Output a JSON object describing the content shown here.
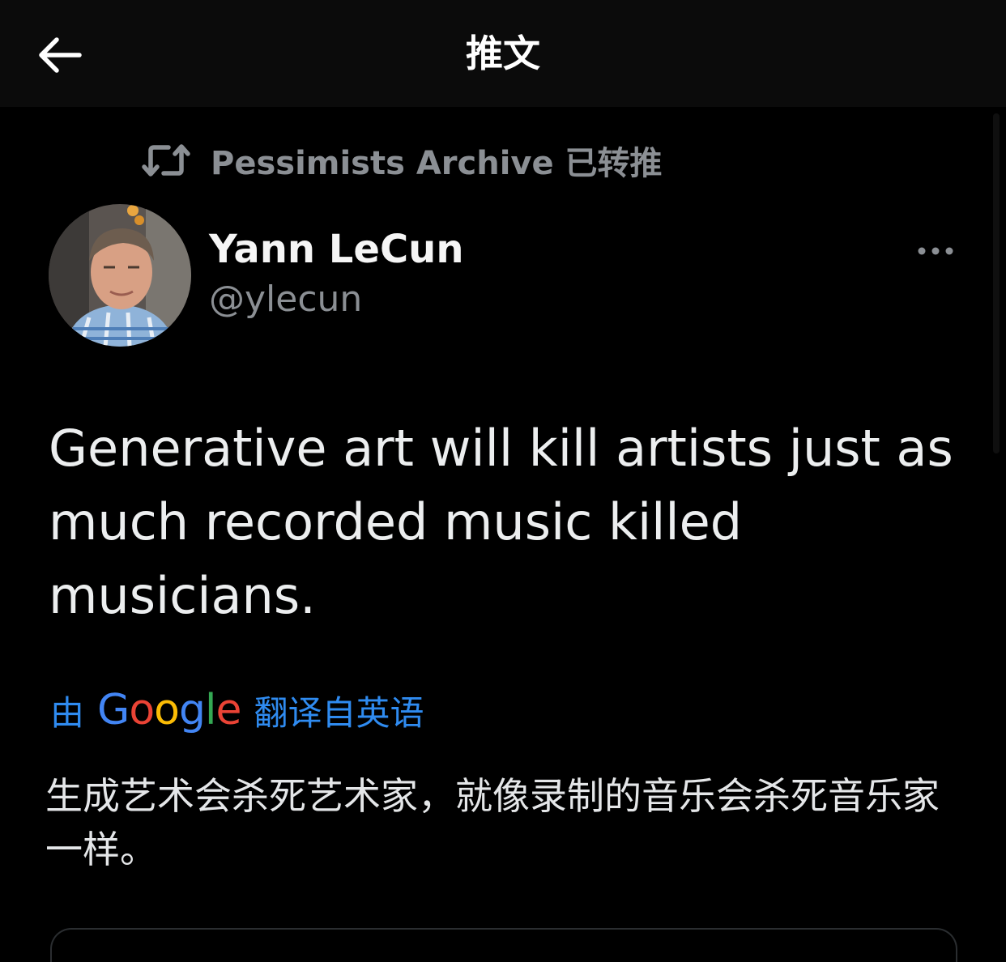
{
  "header": {
    "title": "推文",
    "back_icon": "arrow-left-icon"
  },
  "retweet": {
    "icon": "retweet-icon",
    "text": "Pessimists Archive 已转推"
  },
  "author": {
    "name": "Yann LeCun",
    "handle": "@ylecun",
    "avatar": "avatar-photo"
  },
  "more_icon": "more-horizontal-icon",
  "tweet": {
    "text": "Generative art will kill artists just as much recorded music killed musicians."
  },
  "translation": {
    "by_label": "由",
    "provider": "Google",
    "from_label": "翻译自英语",
    "text": "生成艺术会杀死艺术家，就像录制的音乐会杀死音乐家一样。"
  },
  "colors": {
    "background": "#000000",
    "header_background": "#0b0b0b",
    "primary_text": "#e7e9ea",
    "secondary_text": "#8b8f94",
    "link": "#2f8bf0",
    "google_blue": "#4285f4",
    "google_red": "#ea4335",
    "google_yellow": "#fbbc05",
    "google_green": "#34a853"
  }
}
